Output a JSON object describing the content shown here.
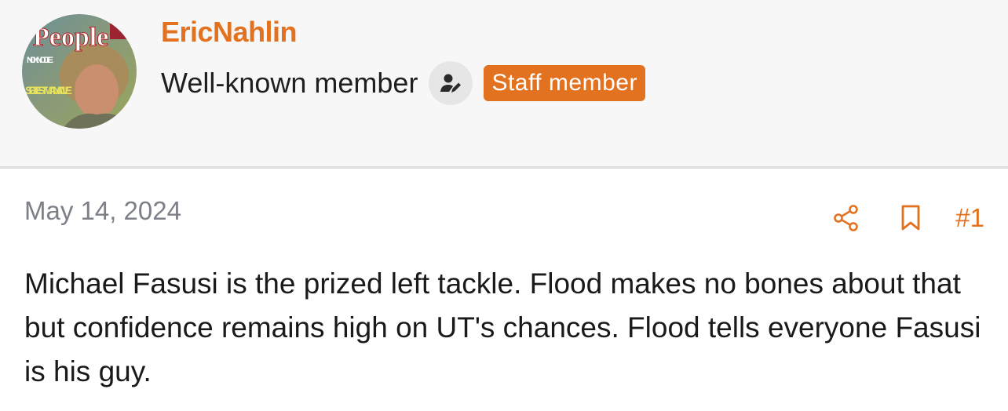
{
  "author": {
    "username": "EricNahlin",
    "role": "Well-known member",
    "badge": "Staff member",
    "avatar_icon": "avatar-magazine-cover",
    "avatar_cover": {
      "masthead": "People",
      "side_text": "NICK NOLTE",
      "headline": "SEXIEST MAN ALIVE"
    }
  },
  "post": {
    "date": "May 14, 2024",
    "number": "#1",
    "body": "Michael Fasusi is the prized left tackle. Flood makes no bones about that but confidence remains high on UT's chances. Flood tells everyone Fasusi is his guy."
  },
  "icons": {
    "role": "user-edit-icon",
    "share": "share-icon",
    "bookmark": "bookmark-icon"
  },
  "colors": {
    "accent": "#e2721f",
    "muted": "#7d8088",
    "header_bg": "#f7f7f7"
  }
}
